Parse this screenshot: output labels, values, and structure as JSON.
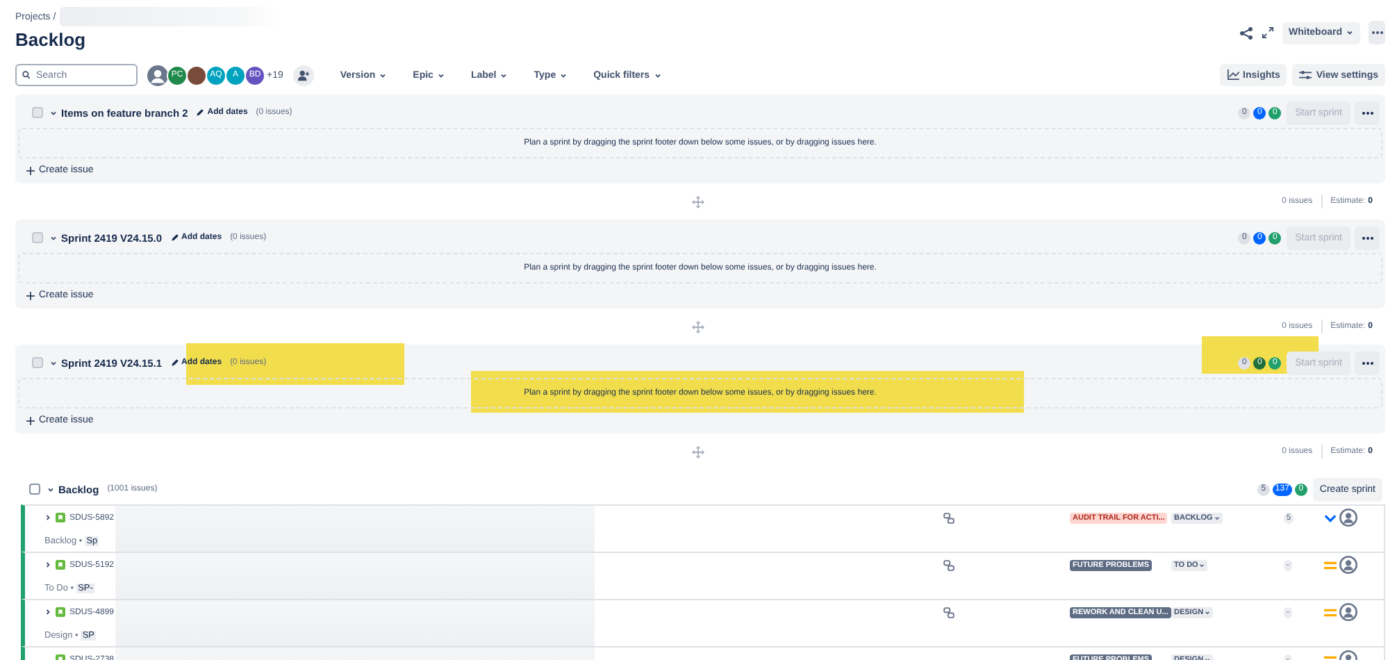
{
  "header": {
    "breadcrumb": "Projects /",
    "title": "Backlog",
    "view_button": "Whiteboard"
  },
  "toolbar": {
    "search": {
      "placeholder": "Search"
    },
    "avatars": [
      {
        "kind": "silhouette",
        "color": "#6b778c"
      },
      {
        "kind": "initials",
        "initials": "PC",
        "color": "#1f8a4c"
      },
      {
        "kind": "photo",
        "color": "#7a4b3a"
      },
      {
        "kind": "initials",
        "initials": "AQ",
        "color": "#00a3bf"
      },
      {
        "kind": "initials",
        "initials": "A",
        "color": "#00a3bf"
      },
      {
        "kind": "initials",
        "initials": "BD",
        "color": "#6554c0"
      }
    ],
    "more_people": "+19",
    "filters": [
      "Version",
      "Epic",
      "Label",
      "Type",
      "Quick filters"
    ],
    "insights": "Insights",
    "view_settings": "View settings"
  },
  "sprints": [
    {
      "checked": false,
      "name": "Items on feature branch 2",
      "add_dates": "Add dates",
      "count": "(0 issues)",
      "empty_text": "Plan a sprint by dragging the sprint footer down below some issues, or by dragging issues here.",
      "counters": [
        {
          "value": "0",
          "color": "#dfe1e6"
        },
        {
          "value": "0",
          "color": "#0065ff"
        },
        {
          "value": "0",
          "color": "#22a06b"
        }
      ],
      "start": "Start sprint",
      "start_disabled": true,
      "create": "Create issue",
      "footer_issues": "0 issues",
      "estimate_label": "Estimate:",
      "estimate": "0",
      "highlighted": false
    },
    {
      "checked": false,
      "name": "Sprint 2419 V24.15.0",
      "add_dates": "Add dates",
      "count": "(0 issues)",
      "empty_text": "Plan a sprint by dragging the sprint footer down below some issues, or by dragging issues here.",
      "counters": [
        {
          "value": "0",
          "color": "#dfe1e6"
        },
        {
          "value": "0",
          "color": "#0065ff"
        },
        {
          "value": "0",
          "color": "#22a06b"
        }
      ],
      "start": "Start sprint",
      "start_disabled": true,
      "create": "Create issue",
      "footer_issues": "0 issues",
      "estimate_label": "Estimate:",
      "estimate": "0",
      "highlighted": false
    },
    {
      "checked": false,
      "name": "Sprint 2419 V24.15.1",
      "add_dates": "Add dates",
      "count": "(0 issues)",
      "empty_text": "Plan a sprint by dragging the sprint footer down below some issues, or by dragging issues here.",
      "counters": [
        {
          "value": "0",
          "color": "#dfe1e6"
        },
        {
          "value": "0",
          "color": "#1f6f3a"
        },
        {
          "value": "0",
          "color": "#22a06b"
        }
      ],
      "start": "Start sprint",
      "start_disabled": true,
      "create": "Create issue",
      "footer_issues": "0 issues",
      "estimate_label": "Estimate:",
      "estimate": "0",
      "highlighted": true
    }
  ],
  "backlog": {
    "name": "Backlog",
    "count": "(1001 issues)",
    "checked": false,
    "counters": [
      {
        "value": "5",
        "color": "#dfe1e6"
      },
      {
        "value": "137",
        "color": "#0065ff"
      },
      {
        "value": "0",
        "color": "#22a06b"
      }
    ],
    "create_sprint": "Create sprint",
    "rows": [
      {
        "kind": "low",
        "key": "SDUS-5892",
        "expandable": true,
        "status_prefix": "Backlog •",
        "tag": "Sp",
        "linked": true,
        "epic": "AUDIT TRAIL FOR ACTI...",
        "color": "#ffd5d2",
        "status": "BACKLOG",
        "estimate": "5"
      },
      {
        "kind": "medium",
        "key": "SDUS-5192",
        "expandable": true,
        "status_prefix": "To Do •",
        "tag": "SP-",
        "linked": true,
        "epic": "FUTURE PROBLEMS",
        "color": "#5e6c84",
        "status": "TO DO",
        "estimate": "-"
      },
      {
        "kind": "medium",
        "key": "SDUS-4899",
        "expandable": true,
        "status_prefix": "Design •",
        "tag": "SP",
        "linked": true,
        "epic": "REWORK AND CLEAN U...",
        "color": "#5e6c84",
        "status": "DESIGN",
        "estimate": "-"
      },
      {
        "kind": "medium",
        "key": "SDUS-2738",
        "expandable": false,
        "linked": false,
        "epic": "FUTURE PROBLEMS",
        "color": "#5e6c84",
        "status": "DESIGN",
        "estimate": "-"
      }
    ]
  }
}
